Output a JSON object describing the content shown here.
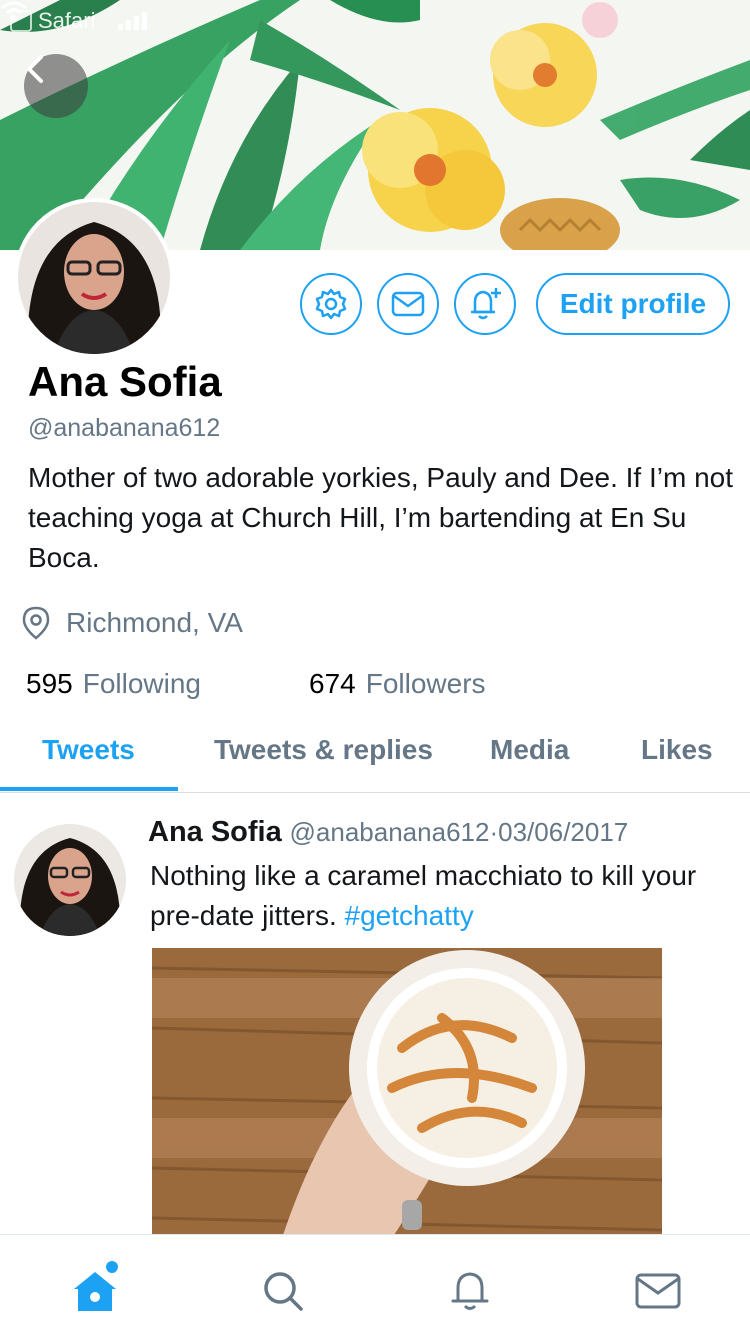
{
  "status_bar": {
    "carrier": "Safari"
  },
  "profile": {
    "name": "Ana Sofia",
    "handle": "@anabanana612",
    "bio": "Mother of two adorable yorkies, Pauly and Dee. If I’m not teaching yoga at Church Hill, I’m bartending at En Su Boca.",
    "location": "Richmond, VA",
    "following_count": "595",
    "following_label": "Following",
    "followers_count": "674",
    "followers_label": "Followers"
  },
  "actions": {
    "edit_label": "Edit profile"
  },
  "tabs": [
    {
      "label": "Tweets",
      "active": true
    },
    {
      "label": "Tweets & replies",
      "active": false
    },
    {
      "label": "Media",
      "active": false
    },
    {
      "label": "Likes",
      "active": false
    }
  ],
  "tweet": {
    "name": "Ana Sofia",
    "handle": "@anabanana612",
    "separator": "·",
    "date": "03/06/2017",
    "text": "Nothing like a caramel macchiato to kill your pre-date jitters.",
    "hashtag": "#getchatty"
  },
  "colors": {
    "accent": "#1da1f2",
    "muted": "#657786"
  },
  "icons": {
    "back": "chevron-left-icon",
    "settings": "gear-icon",
    "message": "envelope-icon",
    "notify": "bell-plus-icon",
    "location": "map-pin-icon",
    "home": "home-icon",
    "search": "search-icon",
    "notifications": "bell-icon",
    "messages": "envelope-icon"
  }
}
